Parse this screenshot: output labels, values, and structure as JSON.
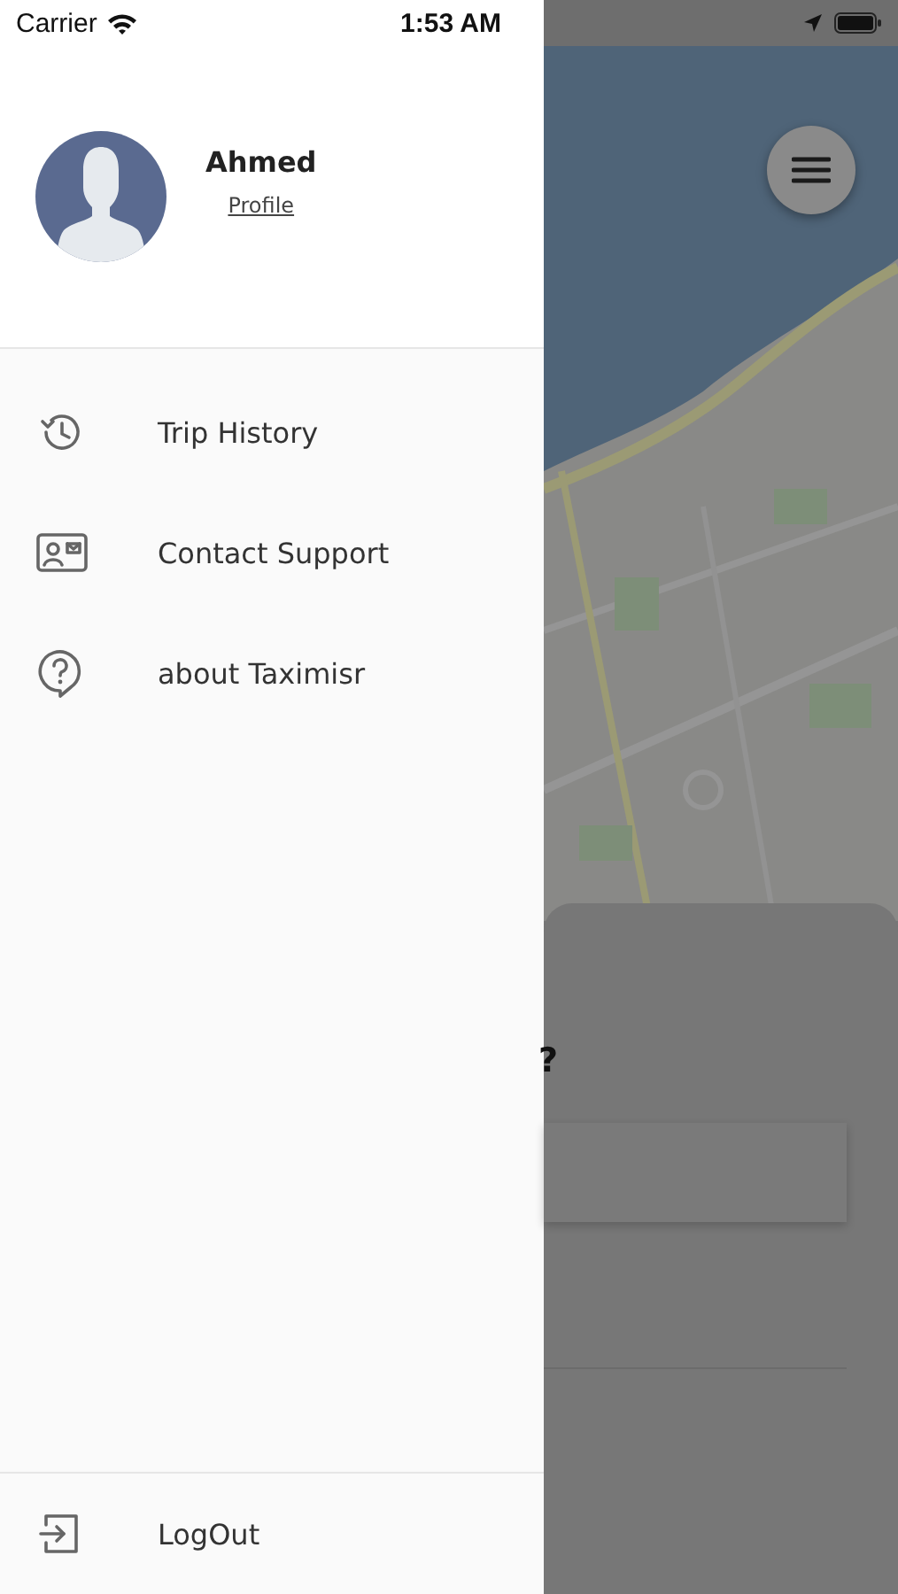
{
  "status_bar": {
    "carrier": "Carrier",
    "time": "1:53 AM"
  },
  "profile": {
    "name": "Ahmed",
    "link": "Profile"
  },
  "menu": [
    {
      "kind": "history",
      "label": "Trip History"
    },
    {
      "kind": "contact",
      "label": "Contact Support"
    },
    {
      "kind": "help",
      "label": "about Taximisr"
    }
  ],
  "footer": {
    "kind": "logout",
    "label": "LogOut"
  },
  "sheet": {
    "heading": "?"
  }
}
